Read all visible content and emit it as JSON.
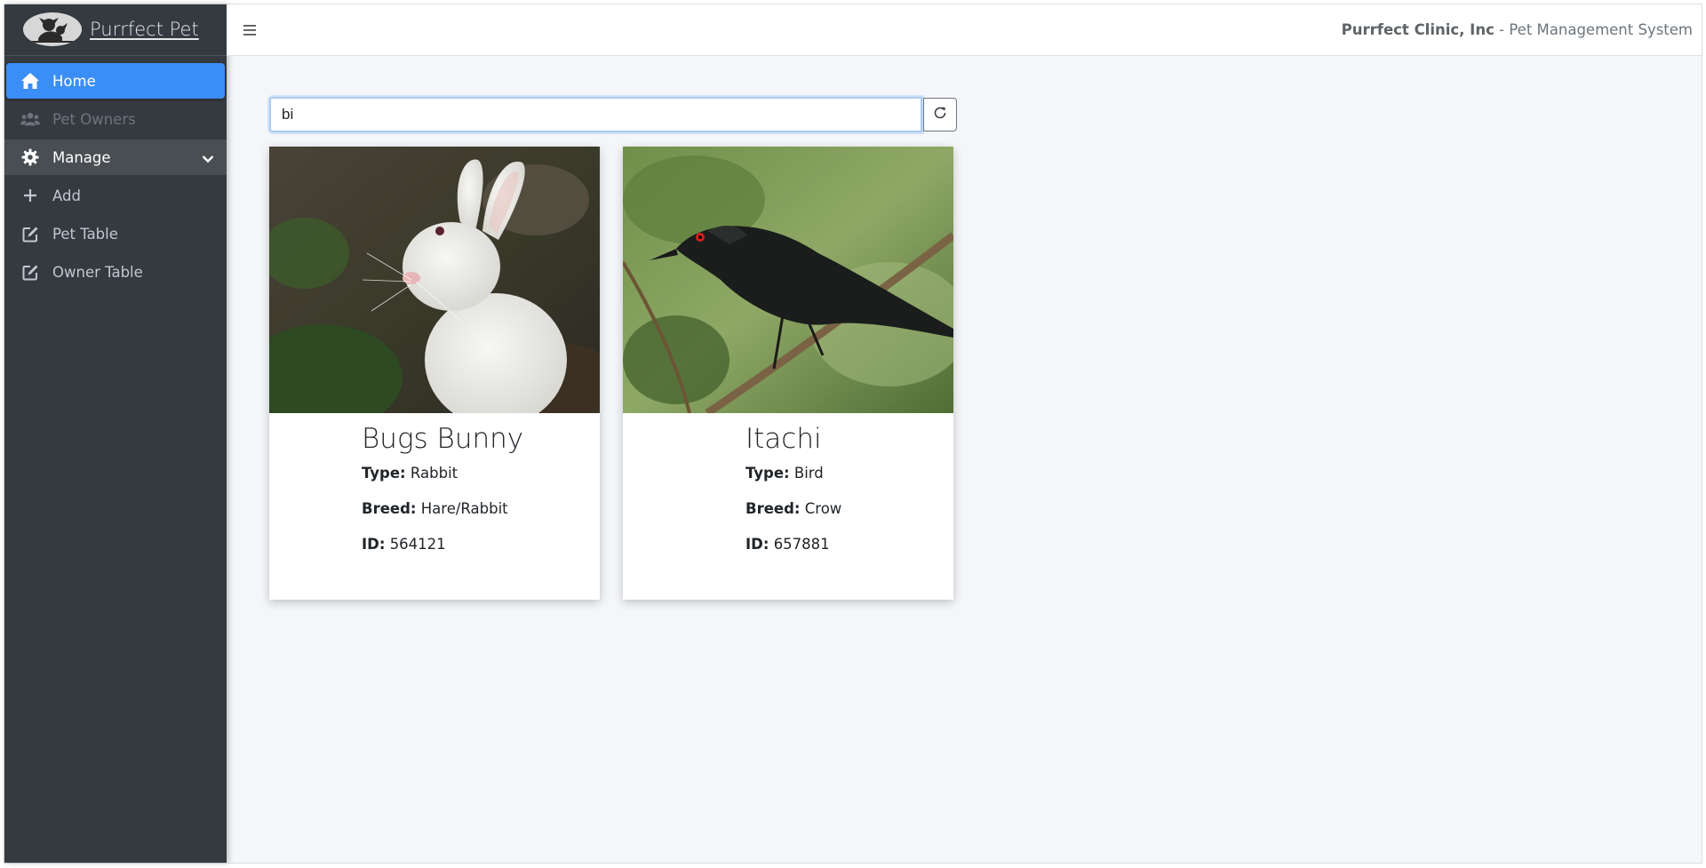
{
  "brand": {
    "name": "Purrfect Pet",
    "logo_icon": "dog-cat-logo-icon"
  },
  "sidebar": {
    "items": [
      {
        "label": "Home",
        "icon": "home-icon",
        "state": "active"
      },
      {
        "label": "Pet Owners",
        "icon": "users-icon",
        "state": "disabled"
      },
      {
        "label": "Manage",
        "icon": "gear-icon",
        "state": "expanded"
      },
      {
        "label": "Add",
        "icon": "plus-icon",
        "state": "normal"
      },
      {
        "label": "Pet Table",
        "icon": "edit-icon",
        "state": "normal"
      },
      {
        "label": "Owner Table",
        "icon": "edit-icon",
        "state": "normal"
      }
    ]
  },
  "header": {
    "company": "Purrfect Clinic, Inc",
    "subtitle": " - Pet Management System",
    "menu_icon": "hamburger-icon"
  },
  "search": {
    "value": "bi",
    "placeholder": "",
    "refresh_icon": "refresh-icon"
  },
  "pets": [
    {
      "name": "Bugs Bunny",
      "type_label": "Type:",
      "type": "Rabbit",
      "breed_label": "Breed:",
      "breed": "Hare/Rabbit",
      "id_label": "ID:",
      "id": "564121"
    },
    {
      "name": "Itachi",
      "type_label": "Type:",
      "type": "Bird",
      "breed_label": "Breed:",
      "breed": "Crow",
      "id_label": "ID:",
      "id": "657881"
    }
  ],
  "colors": {
    "sidebar_bg": "#343a40",
    "active_blue": "#3b8ef5",
    "content_bg": "#f4f6f9"
  }
}
